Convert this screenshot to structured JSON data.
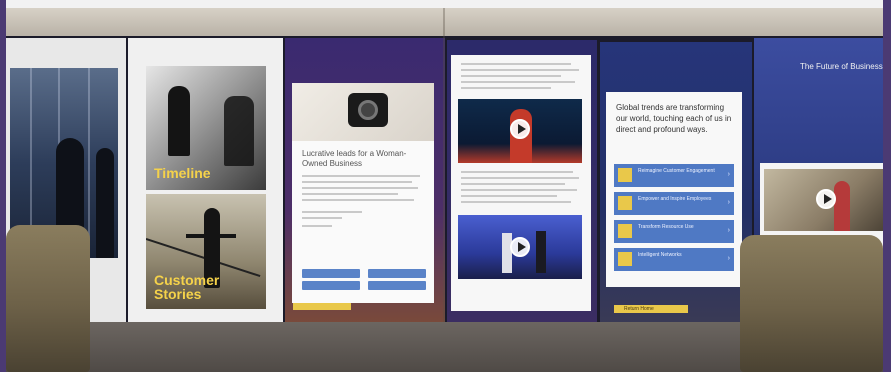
{
  "scene": {
    "colors": {
      "accent_yellow": "#e9c84a",
      "panel_blue": "#4f79c4",
      "wall_purple": "#3a2a70"
    }
  },
  "tiles": {
    "timeline": "Timeline",
    "customer_stories": "Customer Stories"
  },
  "article": {
    "title": "Lucrative leads for a Woman-Owned Business"
  },
  "trends": {
    "headline": "Global trends are transforming our world, touching each of us in direct and profound ways.",
    "options": [
      {
        "label": "Reimagine Customer Engagement",
        "icon": "people-icon"
      },
      {
        "label": "Empower and Inspire Employees",
        "icon": "briefcase-icon"
      },
      {
        "label": "Transform Resource Use",
        "icon": "leaf-icon"
      },
      {
        "label": "Intelligent Networks",
        "icon": "network-icon"
      }
    ],
    "return_label": "Return Home"
  },
  "future": {
    "heading": "The Future of Business"
  }
}
